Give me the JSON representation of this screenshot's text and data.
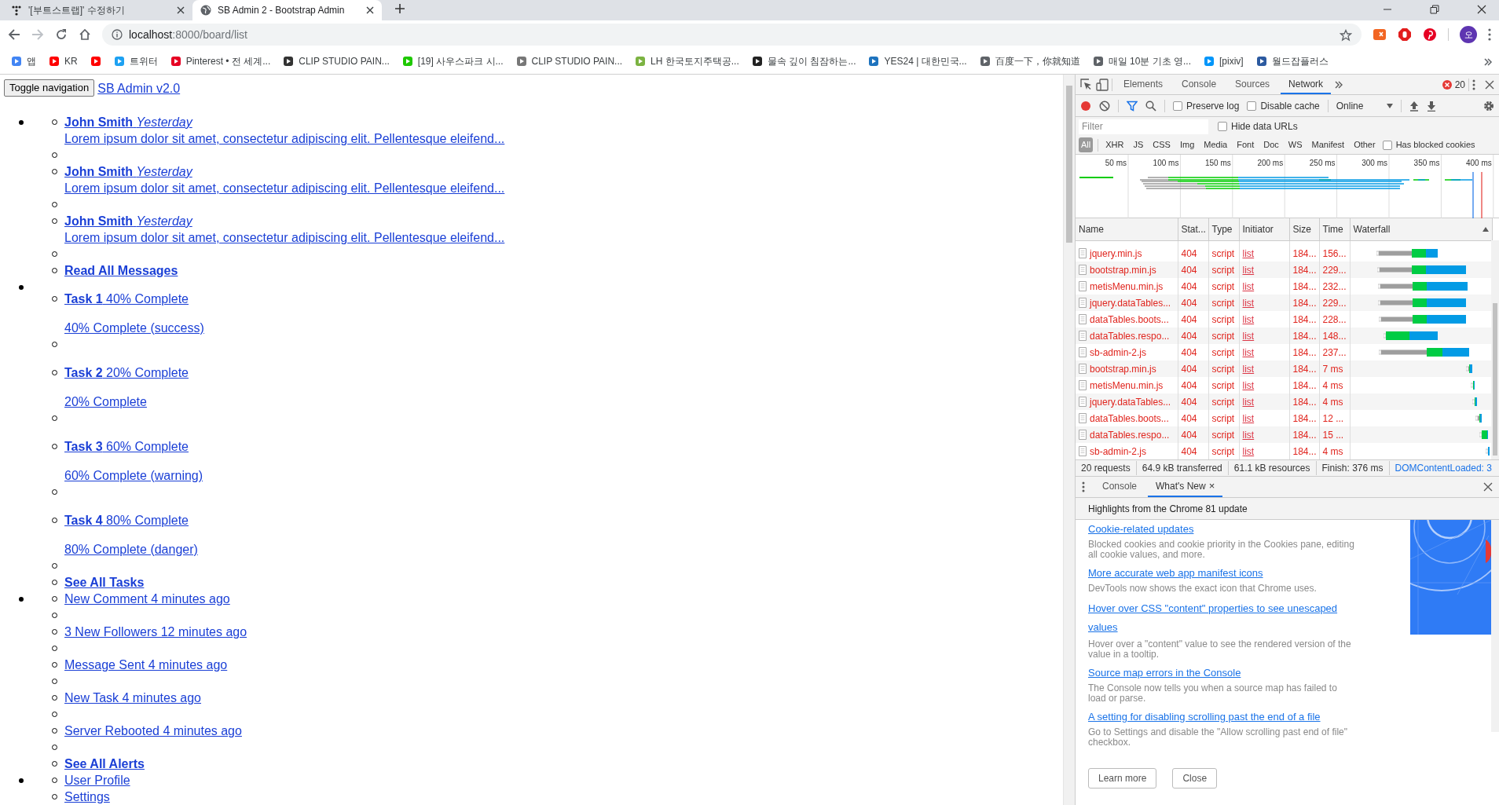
{
  "browser": {
    "tabs": [
      {
        "title": "'[부트스트랩]' 수정하기",
        "selected": false
      },
      {
        "title": "SB Admin 2 - Bootstrap Admin",
        "selected": true
      }
    ],
    "address": {
      "host": "localhost",
      "path": ":8000/board/list"
    },
    "profile_initial": "오",
    "bookmarks": [
      {
        "label": "앱",
        "color": "#4285f4"
      },
      {
        "label": "KR",
        "color": "#ff0000"
      },
      {
        "color": "#ff0000"
      },
      {
        "label": "트위터",
        "color": "#1da1f2"
      },
      {
        "label": "Pinterest • 전 세계...",
        "color": "#e60023"
      },
      {
        "label": "CLIP STUDIO PAIN...",
        "color": "#333333"
      },
      {
        "label": "[19] 사우스파크 시...",
        "color": "#1ec800"
      },
      {
        "label": "CLIP STUDIO PAIN...",
        "color": "#777777"
      },
      {
        "label": "LH 한국토지주택공...",
        "color": "#7cb342"
      },
      {
        "label": "물속 깊이 침잠하는...",
        "color": "#222222"
      },
      {
        "label": "YES24 | 대한민국...",
        "color": "#1e73be"
      },
      {
        "label": "百度一下，你就知道",
        "color": "#5f6368"
      },
      {
        "label": "매일 10분 기초 영...",
        "color": "#5f6368"
      },
      {
        "label": "[pixiv]",
        "color": "#0096fa"
      },
      {
        "label": "월드잡플러스",
        "color": "#2c5aa0"
      }
    ]
  },
  "page": {
    "navbar": {
      "toggle": "Toggle navigation",
      "brand": "SB Admin v2.0"
    },
    "sections": [
      {
        "items": [
          {
            "kind": "message",
            "sender": "**John Smith** *Yesterday*",
            "preview": "Lorem ipsum dolor sit amet, consectetur adipiscing elit. Pellentesque eleifend..."
          },
          {
            "kind": "divider"
          },
          {
            "kind": "message",
            "sender": "**John Smith** *Yesterday*",
            "preview": "Lorem ipsum dolor sit amet, consectetur adipiscing elit. Pellentesque eleifend..."
          },
          {
            "kind": "divider"
          },
          {
            "kind": "message",
            "sender": "**John Smith** *Yesterday*",
            "preview": "Lorem ipsum dolor sit amet, consectetur adipiscing elit. Pellentesque eleifend..."
          },
          {
            "kind": "divider"
          },
          {
            "kind": "footer",
            "label": "Read All Messages"
          }
        ]
      },
      {
        "items": [
          {
            "kind": "task",
            "title": "**Task 1** 40% Complete",
            "progress": "40% Complete (success)"
          },
          {
            "kind": "divider"
          },
          {
            "kind": "task",
            "title": "**Task 2** 20% Complete",
            "progress": "20% Complete"
          },
          {
            "kind": "divider"
          },
          {
            "kind": "task",
            "title": "**Task 3** 60% Complete",
            "progress": "60% Complete (warning)"
          },
          {
            "kind": "divider"
          },
          {
            "kind": "task",
            "title": "**Task 4** 80% Complete",
            "progress": "80% Complete (danger)"
          },
          {
            "kind": "divider"
          },
          {
            "kind": "footer",
            "label": "See All Tasks"
          }
        ]
      },
      {
        "items": [
          {
            "kind": "link",
            "label": "New Comment 4 minutes ago"
          },
          {
            "kind": "divider"
          },
          {
            "kind": "link",
            "label": "3 New Followers 12 minutes ago"
          },
          {
            "kind": "divider"
          },
          {
            "kind": "link",
            "label": "Message Sent 4 minutes ago"
          },
          {
            "kind": "divider"
          },
          {
            "kind": "link",
            "label": "New Task 4 minutes ago"
          },
          {
            "kind": "divider"
          },
          {
            "kind": "link",
            "label": "Server Rebooted 4 minutes ago"
          },
          {
            "kind": "divider"
          },
          {
            "kind": "footer",
            "label": "See All Alerts"
          }
        ]
      },
      {
        "items": [
          {
            "kind": "link",
            "label": "User Profile"
          },
          {
            "kind": "link",
            "label": "Settings"
          }
        ]
      }
    ]
  },
  "devtools": {
    "panels": [
      {
        "label": "Elements",
        "selected": false
      },
      {
        "label": "Console",
        "selected": false
      },
      {
        "label": "Sources",
        "selected": false
      },
      {
        "label": "Network",
        "selected": true
      }
    ],
    "error_count": "20",
    "toolbar": {
      "recording": true,
      "preserve_log": {
        "label": "Preserve log",
        "checked": false
      },
      "disable_cache": {
        "label": "Disable cache",
        "checked": false
      },
      "throttling": "Online"
    },
    "filter": {
      "placeholder": "Filter"
    },
    "hide_data_urls": {
      "label": "Hide data URLs",
      "checked": false
    },
    "types": [
      {
        "label": "All",
        "selected": true
      },
      {
        "label": "XHR",
        "selected": false
      },
      {
        "label": "JS",
        "selected": false
      },
      {
        "label": "CSS",
        "selected": false
      },
      {
        "label": "Img",
        "selected": false
      },
      {
        "label": "Media",
        "selected": false
      },
      {
        "label": "Font",
        "selected": false
      },
      {
        "label": "Doc",
        "selected": false
      },
      {
        "label": "WS",
        "selected": false
      },
      {
        "label": "Manifest",
        "selected": false
      },
      {
        "label": "Other",
        "selected": false
      }
    ],
    "blocked_cookies": {
      "label": "Has blocked cookies",
      "checked": false
    },
    "overview_ticks": [
      "50 ms",
      "100 ms",
      "150 ms",
      "200 ms",
      "250 ms",
      "300 ms",
      "350 ms",
      "400 ms"
    ],
    "table": {
      "columns": [
        "Name",
        "Stat...",
        "Type",
        "Initiator",
        "Size",
        "Time",
        "Waterfall"
      ],
      "rows": [
        {
          "name": "jquery.min.js",
          "status": "404",
          "type": "script",
          "initiator": "list",
          "size": "184...",
          "time": "156...",
          "failed": true
        },
        {
          "name": "bootstrap.min.js",
          "status": "404",
          "type": "script",
          "initiator": "list",
          "size": "184...",
          "time": "229...",
          "failed": true
        },
        {
          "name": "metisMenu.min.js",
          "status": "404",
          "type": "script",
          "initiator": "list",
          "size": "184...",
          "time": "232...",
          "failed": true
        },
        {
          "name": "jquery.dataTables...",
          "status": "404",
          "type": "script",
          "initiator": "list",
          "size": "184...",
          "time": "229...",
          "failed": true
        },
        {
          "name": "dataTables.boots...",
          "status": "404",
          "type": "script",
          "initiator": "list",
          "size": "184...",
          "time": "228...",
          "failed": true
        },
        {
          "name": "dataTables.respo...",
          "status": "404",
          "type": "script",
          "initiator": "list",
          "size": "184...",
          "time": "148...",
          "failed": true
        },
        {
          "name": "sb-admin-2.js",
          "status": "404",
          "type": "script",
          "initiator": "list",
          "size": "184...",
          "time": "237...",
          "failed": true
        },
        {
          "name": "bootstrap.min.js",
          "status": "404",
          "type": "script",
          "initiator": "list",
          "size": "184...",
          "time": "7 ms",
          "failed": true
        },
        {
          "name": "metisMenu.min.js",
          "status": "404",
          "type": "script",
          "initiator": "list",
          "size": "184...",
          "time": "4 ms",
          "failed": true
        },
        {
          "name": "jquery.dataTables...",
          "status": "404",
          "type": "script",
          "initiator": "list",
          "size": "184...",
          "time": "4 ms",
          "failed": true
        },
        {
          "name": "dataTables.boots...",
          "status": "404",
          "type": "script",
          "initiator": "list",
          "size": "184...",
          "time": "12 ...",
          "failed": true
        },
        {
          "name": "dataTables.respo...",
          "status": "404",
          "type": "script",
          "initiator": "list",
          "size": "184...",
          "time": "15 ...",
          "failed": true
        },
        {
          "name": "sb-admin-2.js",
          "status": "404",
          "type": "script",
          "initiator": "list",
          "size": "184...",
          "time": "4 ms",
          "failed": true
        }
      ]
    },
    "summary": [
      "20 requests",
      "64.9 kB transferred",
      "61.1 kB resources",
      "Finish: 376 ms",
      "DOMContentLoaded: 3"
    ],
    "drawer": {
      "tabs": [
        {
          "label": "Console",
          "selected": false,
          "closable": false
        },
        {
          "label": "What's New",
          "selected": true,
          "closable": true
        }
      ],
      "close_tab": "×",
      "heading": "Highlights from the Chrome 81 update",
      "items": [
        {
          "title": "Cookie-related updates",
          "text": "Blocked cookies and cookie priority in the Cookies pane, editing all cookie values, and more."
        },
        {
          "title": "More accurate web app manifest icons",
          "text": "DevTools now shows the exact icon that Chrome uses."
        },
        {
          "title": "Hover over CSS \"content\" properties to see unescaped values",
          "text": "Hover over a \"content\" value to see the rendered version of the value in a tooltip."
        },
        {
          "title": "Source map errors in the Console",
          "text": "The Console now tells you when a source map has failed to load or parse."
        },
        {
          "title": "A setting for disabling scrolling past the end of a file",
          "text": "Go to Settings and disable the \"Allow scrolling past end of file\" checkbox."
        }
      ],
      "buttons": [
        "Learn more",
        "Close"
      ]
    }
  }
}
